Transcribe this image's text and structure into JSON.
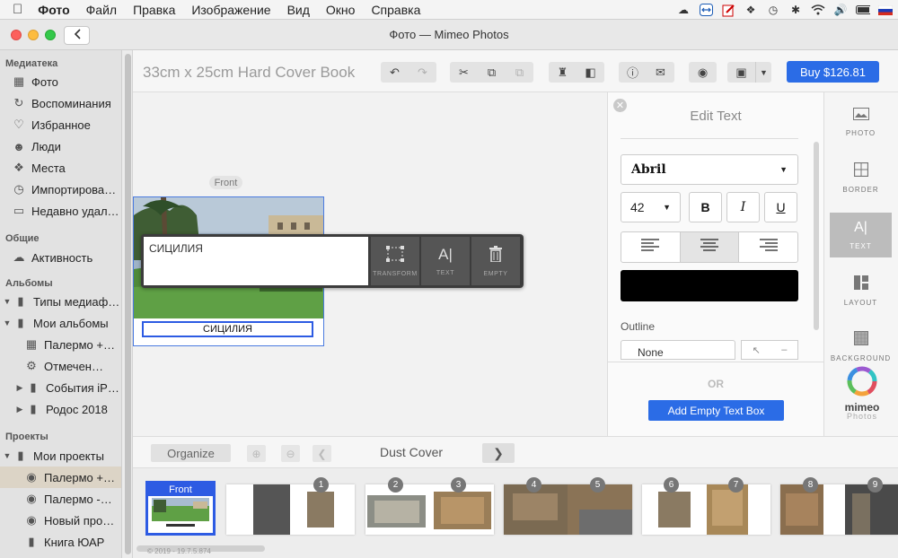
{
  "menubar": {
    "apple": "",
    "items": [
      "Фото",
      "Файл",
      "Правка",
      "Изображение",
      "Вид",
      "Окно",
      "Справка"
    ]
  },
  "window": {
    "title": "Фото — Mimeo Photos"
  },
  "sidebar": {
    "section_library": "Медиатека",
    "library": [
      "Фото",
      "Воспоминания",
      "Избранное",
      "Люди",
      "Места",
      "Импортирова…",
      "Недавно удал…"
    ],
    "section_shared": "Общие",
    "shared": [
      "Активность"
    ],
    "section_albums": "Альбомы",
    "albums": [
      "Типы медиаф…",
      "Мои альбомы",
      "Палермо +…",
      "Отмечен…",
      "События iP…",
      "Родос 2018"
    ],
    "section_projects": "Проекты",
    "projects": [
      "Мои проекты",
      "Палермо +…",
      "Палермо -…",
      "Новый про…",
      "Книга ЮАР"
    ]
  },
  "toolbar": {
    "book_title": "33cm x 25cm Hard Cover Book",
    "buy_label": "Buy $126.81"
  },
  "canvas": {
    "front_label": "Front",
    "caption": "СИЦИЛИЯ"
  },
  "popover": {
    "input_text": "СИЦИЛИЯ",
    "transform_label": "TRANSFORM",
    "text_label": "TEXT",
    "empty_label": "EMPTY"
  },
  "edit_panel": {
    "title": "Edit Text",
    "font": "Abril",
    "size": "42",
    "bold": "B",
    "italic": "I",
    "underline": "U",
    "outline_label": "Outline",
    "outline_value": "None",
    "or_label": "OR",
    "add_button": "Add Empty Text Box",
    "text_color": "#000000"
  },
  "right_panel": {
    "photo": "PHOTO",
    "border": "BORDER",
    "text": "TEXT",
    "layout": "LAYOUT",
    "background": "BACKGROUND",
    "logo_word": "mimeo",
    "logo_sub": "Photos"
  },
  "nav": {
    "organize": "Organize",
    "page_name": "Dust Cover"
  },
  "strip": {
    "front_badge": "Front",
    "numbers": [
      "1",
      "2",
      "3",
      "4",
      "5",
      "6",
      "7",
      "8",
      "9"
    ],
    "copyright": "© 2019 - 19.7.5.874"
  },
  "colors": {
    "accent": "#2b6ce6",
    "selection": "#2d5be3"
  }
}
